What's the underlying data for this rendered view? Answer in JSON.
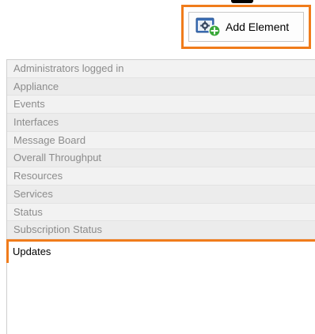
{
  "toolbar": {
    "add_element_label": "Add Element",
    "button_icon": "gear-add-icon"
  },
  "colors": {
    "highlight_border": "#f07c1b",
    "icon_blue": "#3b6fb6",
    "icon_green": "#3aa83a",
    "inactive_text": "#8c8c8c",
    "active_text": "#000000"
  },
  "element_list": {
    "items": [
      {
        "label": "Administrators logged in",
        "state": "inactive"
      },
      {
        "label": "Appliance",
        "state": "inactive"
      },
      {
        "label": "Events",
        "state": "inactive"
      },
      {
        "label": "Interfaces",
        "state": "inactive"
      },
      {
        "label": "Message Board",
        "state": "inactive"
      },
      {
        "label": "Overall Throughput",
        "state": "inactive"
      },
      {
        "label": "Resources",
        "state": "inactive"
      },
      {
        "label": "Services",
        "state": "inactive"
      },
      {
        "label": "Status",
        "state": "inactive"
      },
      {
        "label": "Subscription Status",
        "state": "inactive"
      },
      {
        "label": "Updates",
        "state": "selected"
      }
    ]
  }
}
